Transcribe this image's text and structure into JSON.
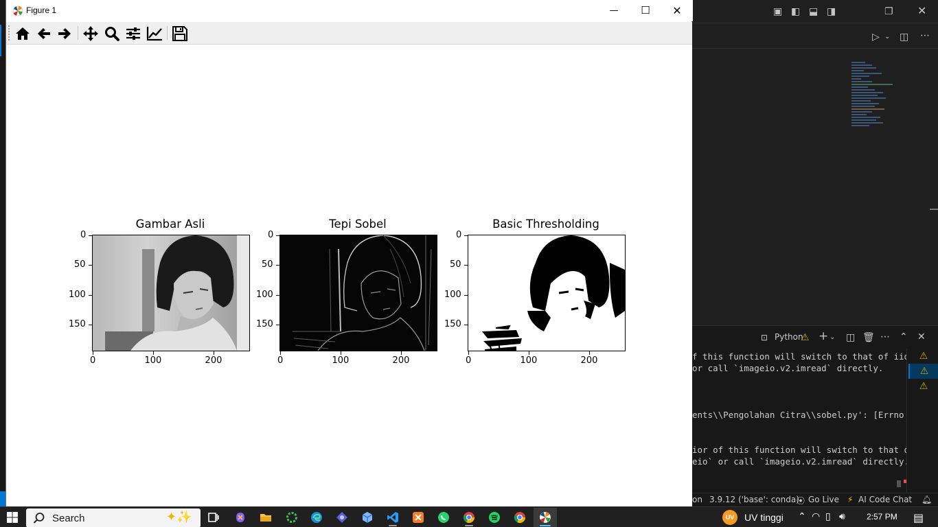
{
  "figure": {
    "window_title": "Figure 1",
    "toolbar": {
      "home": "home-icon",
      "back": "arrow-left-icon",
      "forward": "arrow-right-icon",
      "pan": "move-icon",
      "zoom": "magnifier-icon",
      "subplots": "sliders-icon",
      "edit": "line-chart-icon",
      "save": "floppy-icon"
    }
  },
  "chart_data": [
    {
      "type": "image",
      "title": "Gambar Asli",
      "x_ticks": [
        "0",
        "100",
        "200"
      ],
      "y_ticks": [
        "0",
        "50",
        "100",
        "150"
      ],
      "xlim": [
        0,
        259
      ],
      "ylim": [
        194,
        0
      ]
    },
    {
      "type": "image",
      "title": "Tepi Sobel",
      "x_ticks": [
        "0",
        "100",
        "200"
      ],
      "y_ticks": [
        "0",
        "50",
        "100",
        "150"
      ],
      "xlim": [
        0,
        259
      ],
      "ylim": [
        194,
        0
      ]
    },
    {
      "type": "image",
      "title": "Basic Thresholding",
      "x_ticks": [
        "0",
        "100",
        "200"
      ],
      "y_ticks": [
        "0",
        "50",
        "100",
        "150"
      ],
      "xlim": [
        0,
        259
      ],
      "ylim": [
        194,
        0
      ]
    }
  ],
  "vscode": {
    "terminal_profile": "Python",
    "terminal_lines": [
      "f this function will switch to that of iio",
      "or call `imageio.v2.imread` directly.",
      "",
      "",
      "ents\\\\Pengolahan Citra\\\\sobel.py': [Errno",
      "",
      "",
      "ior of this function will switch to that o",
      "eio` or call `imageio.v2.imread` directly."
    ],
    "status": {
      "lang_frag": "on",
      "interpreter": "3.9.12 ('base': conda)",
      "golive": "Go Live",
      "aichat": "AI Code Chat"
    }
  },
  "taskbar": {
    "search_label": "Search",
    "weather_badge": "UV",
    "weather_text": "UV tinggi",
    "time": "2:57 PM"
  }
}
